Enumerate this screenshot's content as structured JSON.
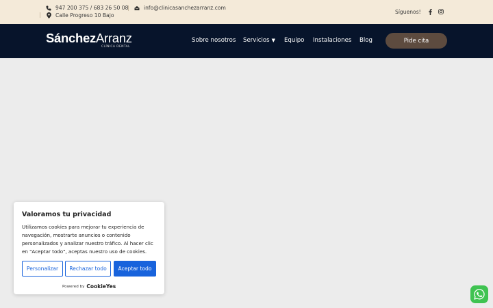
{
  "topbar": {
    "phone": "947 200 375 / 683 26 50 08",
    "email": "info@clinicasanchezarranz.com",
    "address": "Calle Progreso 10 Bajo",
    "follow_label": "Síguenos!",
    "icons": [
      "phone-icon",
      "mail-icon",
      "location-pin-icon",
      "facebook-icon",
      "instagram-icon"
    ]
  },
  "nav": {
    "logo_bold": "Sánchez",
    "logo_light": "Arranz",
    "logo_sub": "CLÍNICA DENTAL",
    "links": [
      "Sobre nosotros",
      "Servicios",
      "Equipo",
      "Instalaciones",
      "Blog"
    ],
    "cta": "Pide cita"
  },
  "cookie": {
    "title": "Valoramos tu privacidad",
    "text": "Utilizamos cookies para mejorar tu experiencia de navegación, mostrarte anuncios o contenido personalizados y analizar nuestro tráfico. Al hacer clic en \"Aceptar todo\", aceptas nuestro uso de cookies.",
    "btn_customize": "Personalizar",
    "btn_reject": "Rechazar todo",
    "btn_accept": "Aceptar todo",
    "powered_by": "Powered by",
    "powered_brand": "CookieYes"
  },
  "colors": {
    "topbar_bg": "#f4ead9",
    "navbar_bg": "#07142b",
    "cta_bg": "#5d4b3f",
    "cookie_accent": "#1863dc",
    "whatsapp": "#3fc351"
  }
}
